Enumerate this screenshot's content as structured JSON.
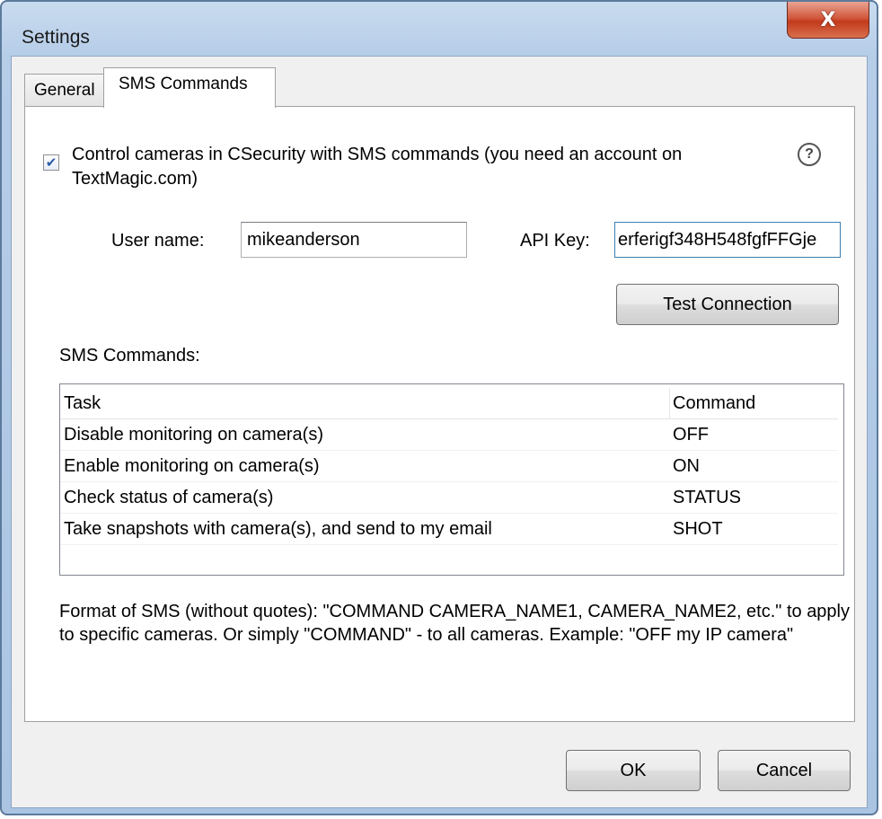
{
  "window": {
    "title": "Settings",
    "close_label": "X"
  },
  "tabs": [
    {
      "label": "General",
      "active": false
    },
    {
      "label": "SMS Commands",
      "active": true
    }
  ],
  "sms": {
    "enable_checked": true,
    "enable_label": "Control cameras in CSecurity with SMS commands (you need an account on TextMagic.com)",
    "help_icon": "?",
    "username_label": "User name:",
    "username_value": "mikeanderson",
    "apikey_label": "API Key:",
    "apikey_value": "erferigf348H548fgfFFGje",
    "test_connection_label": "Test Connection",
    "commands_heading": "SMS Commands:",
    "table": {
      "columns": [
        "Task",
        "Command"
      ],
      "rows": [
        {
          "task": "Disable monitoring on camera(s)",
          "command": "OFF"
        },
        {
          "task": "Enable monitoring on camera(s)",
          "command": "ON"
        },
        {
          "task": "Check status of camera(s)",
          "command": "STATUS"
        },
        {
          "task": "Take snapshots with camera(s), and send to my email",
          "command": "SHOT"
        }
      ]
    },
    "format_note": "Format of SMS (without quotes): \"COMMAND CAMERA_NAME1, CAMERA_NAME2, etc.\"  to apply to specific cameras. Or simply \"COMMAND\" - to all cameras. Example: \"OFF my IP camera\""
  },
  "footer": {
    "ok_label": "OK",
    "cancel_label": "Cancel"
  }
}
